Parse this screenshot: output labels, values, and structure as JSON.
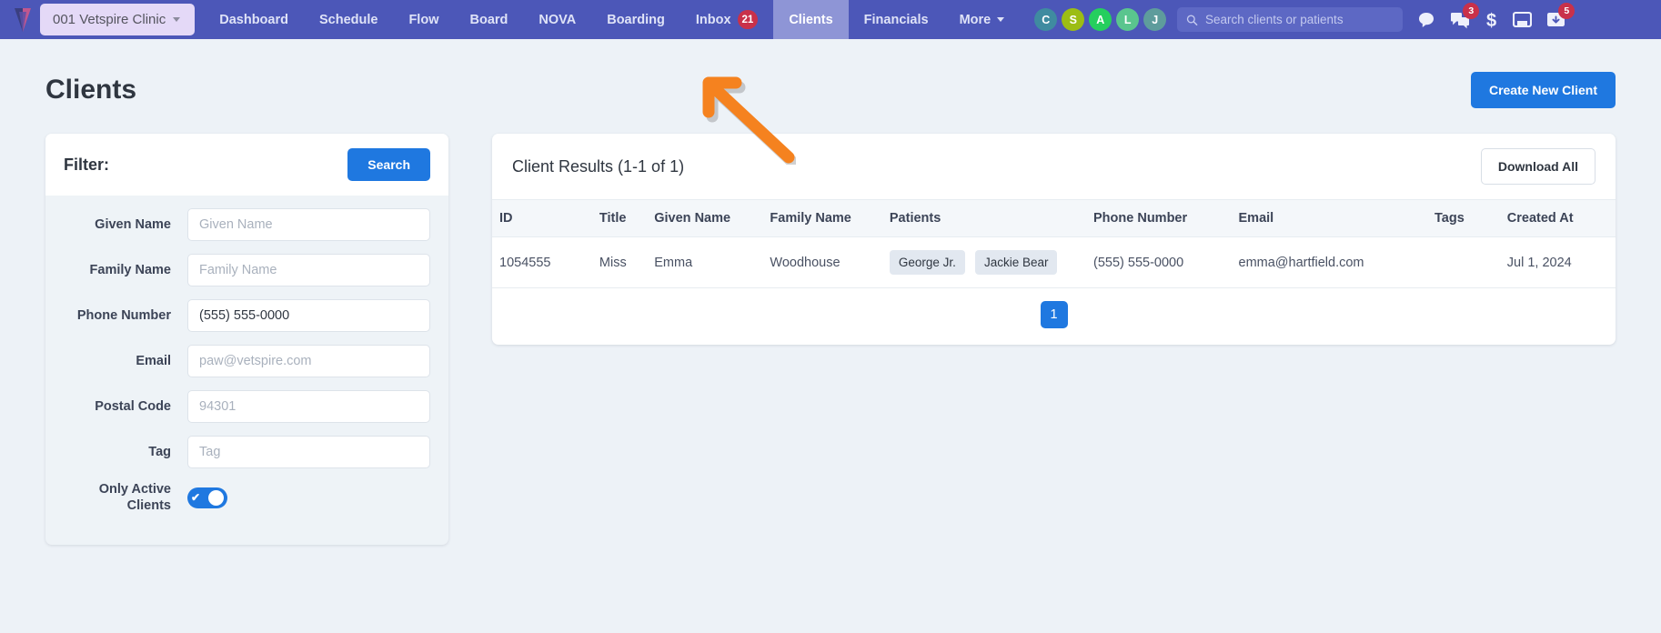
{
  "topnav": {
    "logo_icon": "vetspire-logo-icon",
    "clinic_selector": "001 Vetspire Clinic",
    "items": [
      {
        "label": "Dashboard",
        "active": false,
        "badge": ""
      },
      {
        "label": "Schedule",
        "active": false,
        "badge": ""
      },
      {
        "label": "Flow",
        "active": false,
        "badge": ""
      },
      {
        "label": "Board",
        "active": false,
        "badge": ""
      },
      {
        "label": "NOVA",
        "active": false,
        "badge": ""
      },
      {
        "label": "Boarding",
        "active": false,
        "badge": ""
      },
      {
        "label": "Inbox",
        "active": false,
        "badge": "21"
      },
      {
        "label": "Clients",
        "active": true,
        "badge": ""
      },
      {
        "label": "Financials",
        "active": false,
        "badge": ""
      },
      {
        "label": "More",
        "active": false,
        "badge": "",
        "has_caret": true
      }
    ],
    "avatars": [
      {
        "initial": "C",
        "color": "#3f8ba0"
      },
      {
        "initial": "S",
        "color": "#9cbd14"
      },
      {
        "initial": "A",
        "color": "#25cf5e"
      },
      {
        "initial": "L",
        "color": "#5ac58e"
      },
      {
        "initial": "J",
        "color": "#5e9c9c"
      }
    ],
    "search": {
      "placeholder": "Search clients or patients",
      "value": "",
      "icon": "search-icon"
    },
    "right_icons": [
      {
        "name": "chat-bubble-icon",
        "badge": ""
      },
      {
        "name": "comments-icon",
        "badge": "3"
      },
      {
        "name": "dollar-sign-icon",
        "badge": ""
      },
      {
        "name": "inbox-tray-icon",
        "badge": ""
      },
      {
        "name": "mail-download-icon",
        "badge": "5"
      }
    ]
  },
  "page": {
    "title": "Clients",
    "create_button": "Create New Client"
  },
  "filter": {
    "heading": "Filter:",
    "search_button": "Search",
    "fields": [
      {
        "label": "Given Name",
        "placeholder": "Given Name",
        "value": "",
        "name": "given-name-input"
      },
      {
        "label": "Family Name",
        "placeholder": "Family Name",
        "value": "",
        "name": "family-name-input"
      },
      {
        "label": "Phone Number",
        "placeholder": "(555) 555-0000",
        "value": "(555) 555-0000",
        "name": "phone-number-input"
      },
      {
        "label": "Email",
        "placeholder": "paw@vetspire.com",
        "value": "",
        "name": "email-input"
      },
      {
        "label": "Postal Code",
        "placeholder": "94301",
        "value": "",
        "name": "postal-code-input"
      },
      {
        "label": "Tag",
        "placeholder": "Tag",
        "value": "",
        "name": "tag-input"
      }
    ],
    "toggle_label": "Only Active Clients",
    "toggle_on": true
  },
  "results": {
    "title": "Client Results (1-1 of 1)",
    "download_button": "Download All",
    "columns": [
      "ID",
      "Title",
      "Given Name",
      "Family Name",
      "Patients",
      "Phone Number",
      "Email",
      "Tags",
      "Created At"
    ],
    "rows": [
      {
        "id": "1054555",
        "title": "Miss",
        "given_name": "Emma",
        "family_name": "Woodhouse",
        "patients": [
          "George Jr.",
          "Jackie Bear"
        ],
        "phone": "(555) 555-0000",
        "email": "emma@hartfield.com",
        "tags": "",
        "created_at": "Jul 1, 2024"
      }
    ],
    "pagination": {
      "current": "1"
    }
  },
  "annotation": {
    "arrow_color": "#f5821f",
    "points_to": "Clients"
  },
  "colors": {
    "nav_bg": "#4c57b8",
    "nav_active": "#8e95d6",
    "accent_blue": "#1f78e0",
    "badge_red": "#c9314a",
    "page_bg": "#edf2f7"
  }
}
